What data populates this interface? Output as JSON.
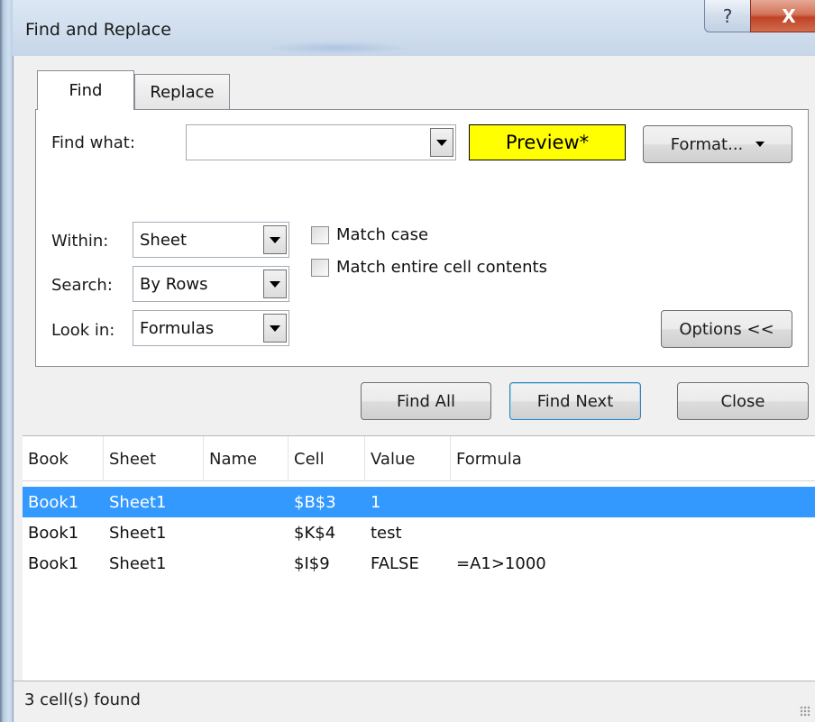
{
  "window": {
    "title": "Find and Replace",
    "help_glyph": "?",
    "close_glyph": "X"
  },
  "tabs": [
    {
      "label": "Find",
      "selected": true
    },
    {
      "label": "Replace",
      "selected": false
    }
  ],
  "find": {
    "find_what_label": "Find what:",
    "find_what_value": "",
    "preview_label": "Preview*",
    "preview_color": "#ffff00",
    "format_label": "Format...",
    "within_label": "Within:",
    "within_value": "Sheet",
    "search_label": "Search:",
    "search_value": "By Rows",
    "look_in_label": "Look in:",
    "look_in_value": "Formulas",
    "match_case_label": "Match case",
    "match_case_checked": false,
    "match_entire_label": "Match entire cell contents",
    "match_entire_checked": false,
    "options_label": "Options <<"
  },
  "buttons": {
    "find_all": "Find All",
    "find_next": "Find Next",
    "close": "Close"
  },
  "results": {
    "columns": [
      "Book",
      "Sheet",
      "Name",
      "Cell",
      "Value",
      "Formula"
    ],
    "rows": [
      {
        "book": "Book1",
        "sheet": "Sheet1",
        "name": "",
        "cell": "$B$3",
        "value": "1",
        "formula": "",
        "selected": true
      },
      {
        "book": "Book1",
        "sheet": "Sheet1",
        "name": "",
        "cell": "$K$4",
        "value": "test",
        "formula": "",
        "selected": false
      },
      {
        "book": "Book1",
        "sheet": "Sheet1",
        "name": "",
        "cell": "$I$9",
        "value": "FALSE",
        "formula": "=A1>1000",
        "selected": false
      }
    ],
    "selection_color": "#3399ff"
  },
  "status": {
    "text": "3 cell(s) found"
  }
}
